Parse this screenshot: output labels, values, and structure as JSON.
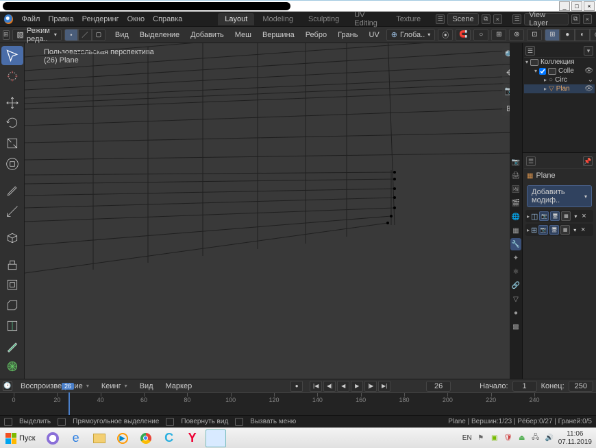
{
  "window": {
    "minimize": "_",
    "maximize": "□",
    "close": "×"
  },
  "menu": {
    "file": "Файл",
    "edit": "Правка",
    "render": "Рендеринг",
    "window": "Окно",
    "help": "Справка"
  },
  "workspaces": {
    "layout": "Layout",
    "modeling": "Modeling",
    "sculpting": "Sculpting",
    "uv": "UV Editing",
    "texture": "Texture"
  },
  "topright": {
    "scene_label": "Scene",
    "layer_label": "View Layer"
  },
  "hdr": {
    "mode": "Режим реда..",
    "view": "Вид",
    "select": "Выделение",
    "add": "Добавить",
    "mesh": "Меш",
    "vertex": "Вершина",
    "edge": "Ребро",
    "face": "Грань",
    "uv": "UV",
    "orient": "Глоба..",
    "pivot": "⦿"
  },
  "viewport": {
    "line1": "Пользовательская перспектива",
    "line2": "(26) Plane"
  },
  "outliner": {
    "title": "Коллекция",
    "coll": "Colle",
    "cam": "Circ",
    "plane": "Plane",
    "plane_short": "Plan"
  },
  "props": {
    "obj": "Plane",
    "add_mod": "Добавить модиф.."
  },
  "timeline": {
    "play": "Воспроизведение",
    "keying": "Кеинг",
    "view": "Вид",
    "marker": "Маркер",
    "frame": "26",
    "start_label": "Начало:",
    "start": "1",
    "end_label": "Конец:",
    "end": "250",
    "ticks": [
      "0",
      "20",
      "40",
      "60",
      "80",
      "100",
      "120",
      "140",
      "160",
      "180",
      "200",
      "220",
      "240"
    ]
  },
  "status": {
    "select": "Выделить",
    "box": "Прямоугольное выделение",
    "rotate": "Повернуть вид",
    "menu": "Вызвать меню",
    "stats": "Plane | Вершин:1/23 | Рёбер:0/27 | Граней:0/5"
  },
  "taskbar": {
    "start": "Пуск",
    "lang": "EN",
    "time": "11:06",
    "date": "07.11.2019"
  }
}
